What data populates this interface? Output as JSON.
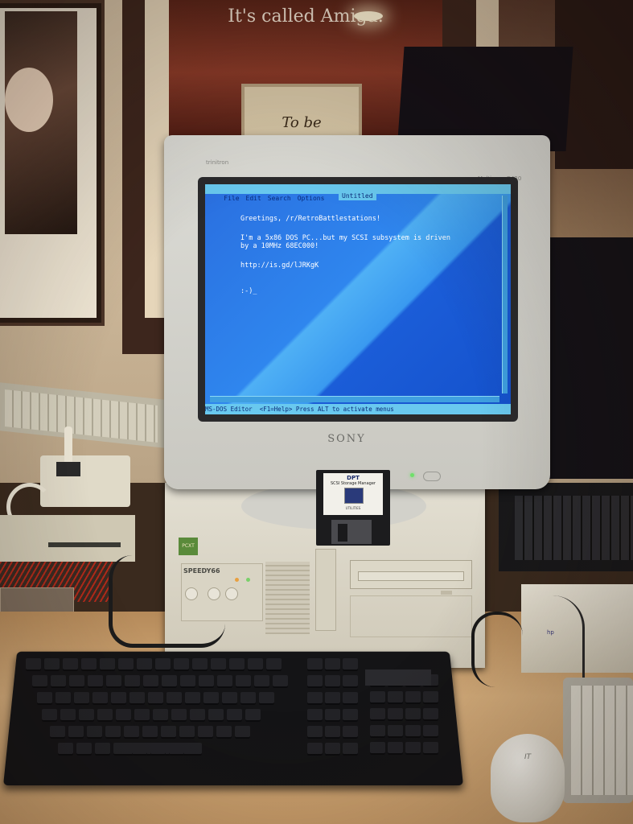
{
  "scene": {
    "poster_text": "It's called Amiga.",
    "small_frame_text": "To be",
    "monitor_brand": "SONY",
    "monitor_top_label": "trinitron",
    "monitor_model": "Multiscan G420",
    "pc_label": "SPEEDY66",
    "pc_logo": "PCXT",
    "hp_label": "hp",
    "mouse_logo": "IT"
  },
  "screen": {
    "menu": [
      "File",
      "Edit",
      "Search",
      "Options"
    ],
    "doc_name": "Untitled",
    "lines": [
      "Greetings, /r/RetroBattlestations!",
      "",
      "I'm a 5x86 DOS PC...but my SCSI subsystem is driven",
      "by a 10MHz 68EC000!",
      "",
      "http://is.gd/lJRKgK",
      "",
      "",
      ":-)_"
    ],
    "status": "MS-DOS Editor  <F1=Help> Press ALT to activate menus"
  },
  "floppy": {
    "brand": "DPT",
    "title": "SCSI Storage Manager",
    "subtitle": "UTILITIES"
  },
  "colors": {
    "screen_blue": "#1f6fe0",
    "screen_text": "#ffffff",
    "menu_cyan": "#69c9ef",
    "led_green": "#6fe06a",
    "led_amber": "#e8a040"
  }
}
